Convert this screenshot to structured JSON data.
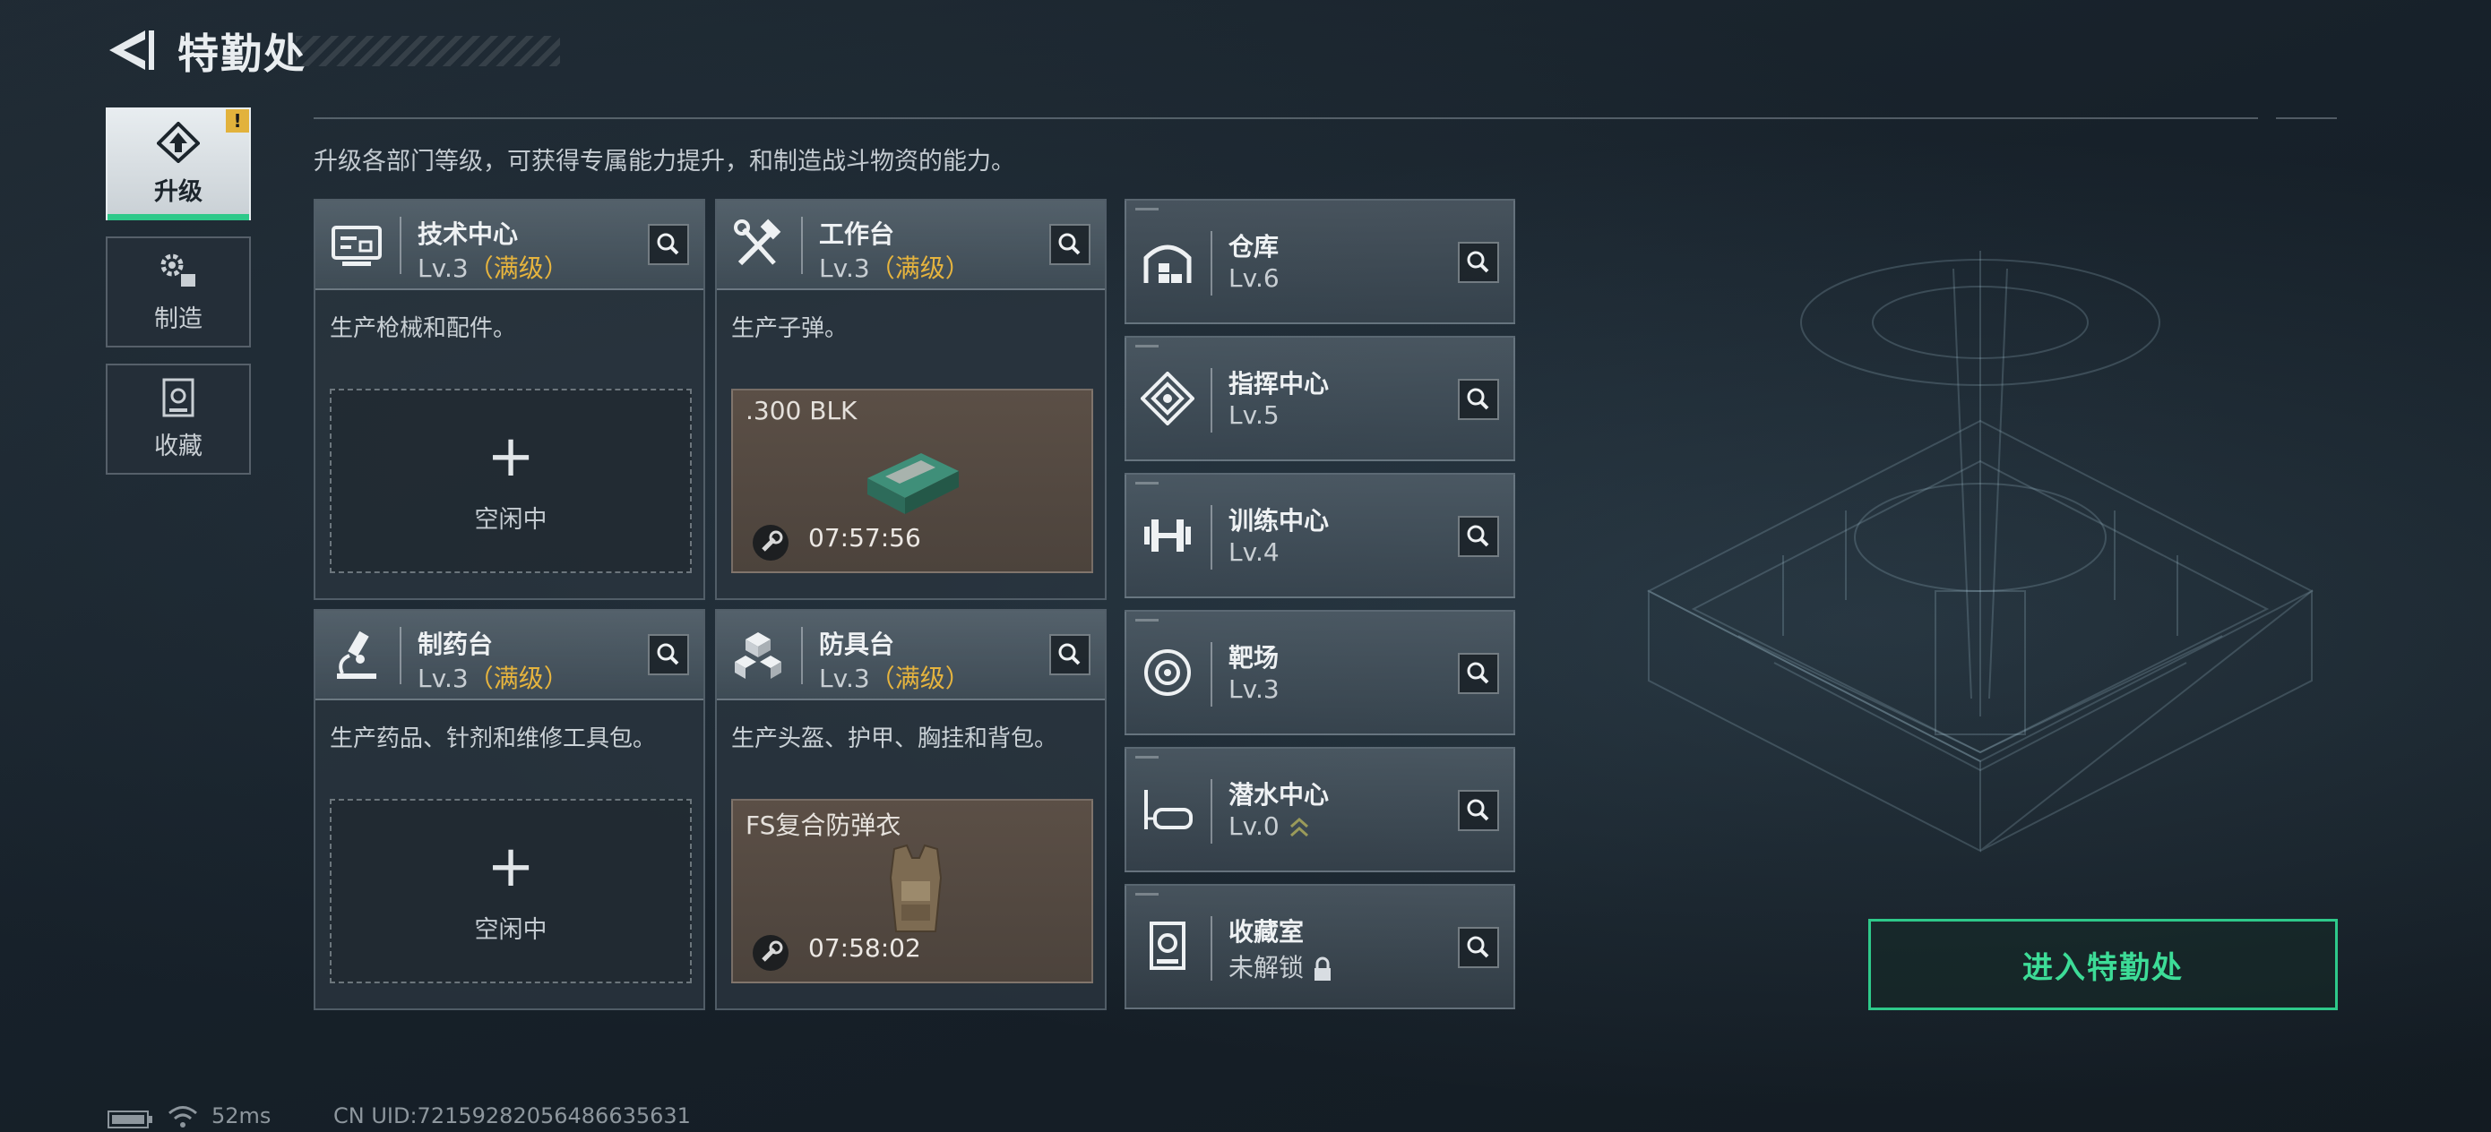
{
  "header": {
    "title": "特勤处"
  },
  "sidebar": {
    "tabs": [
      {
        "label": "升级",
        "badge": "!"
      },
      {
        "label": "制造"
      },
      {
        "label": "收藏"
      }
    ]
  },
  "description": "升级各部门等级，可获得专属能力提升，和制造战斗物资的能力。",
  "departments": [
    {
      "name": "技术中心",
      "level": "Lv.3",
      "maxed": "（满级）",
      "desc": "生产枪械和配件。",
      "slot": {
        "plus": "+",
        "status": "空闲中"
      }
    },
    {
      "name": "工作台",
      "level": "Lv.3",
      "maxed": "（满级）",
      "desc": "生产子弹。",
      "slot": {
        "item": ".300 BLK",
        "timer": "07:57:56"
      }
    },
    {
      "name": "制药台",
      "level": "Lv.3",
      "maxed": "（满级）",
      "desc": "生产药品、针剂和维修工具包。",
      "slot": {
        "plus": "+",
        "status": "空闲中"
      }
    },
    {
      "name": "防具台",
      "level": "Lv.3",
      "maxed": "（满级）",
      "desc": "生产头盔、护甲、胸挂和背包。",
      "slot": {
        "item": "FS复合防弹衣",
        "timer": "07:58:02"
      }
    }
  ],
  "facilities": [
    {
      "name": "仓库",
      "level": "Lv.6"
    },
    {
      "name": "指挥中心",
      "level": "Lv.5"
    },
    {
      "name": "训练中心",
      "level": "Lv.4"
    },
    {
      "name": "靶场",
      "level": "Lv.3"
    },
    {
      "name": "潜水中心",
      "level": "Lv.0"
    },
    {
      "name": "收藏室",
      "level": "未解锁"
    }
  ],
  "enter_button": "进入特勤处",
  "status_bar": {
    "ping": "52ms",
    "uid": "CN UID:72159282056486635631"
  },
  "colors": {
    "accent_green": "#2ec98a",
    "maxed_gold": "#e6b43e",
    "alert_yellow": "#e2b23c"
  }
}
